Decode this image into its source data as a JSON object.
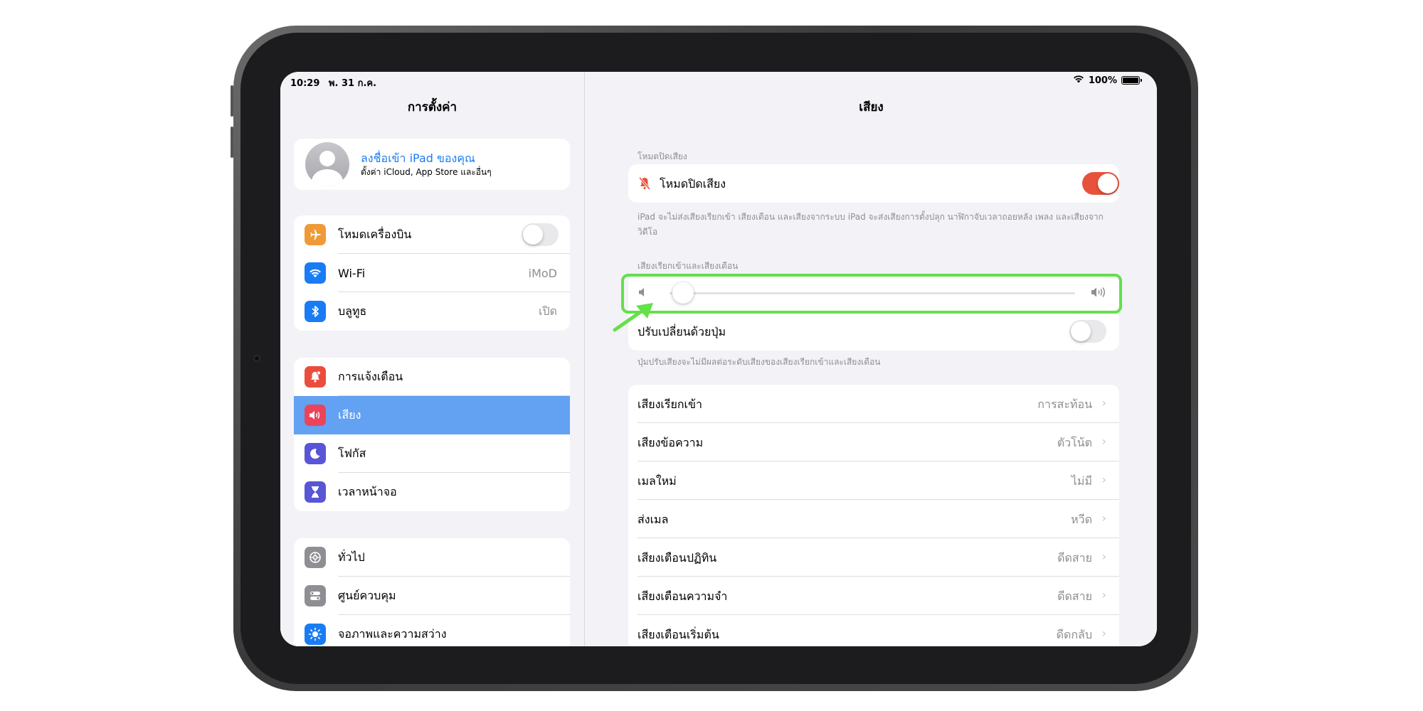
{
  "status_bar": {
    "time": "10:29",
    "date": "พ. 31 ก.ค.",
    "battery": "100%"
  },
  "sidebar": {
    "title": "การตั้งค่า",
    "profile": {
      "name": "ลงชื่อเข้า iPad ของคุณ",
      "subtitle": "ตั้งค่า iCloud, App Store และอื่นๆ"
    },
    "group1": [
      {
        "label": "โหมดเครื่องบิน",
        "icon": "airplane-icon",
        "color": "#f09a37"
      },
      {
        "label": "Wi-Fi",
        "value": "iMoD",
        "icon": "wifi-icon",
        "color": "#1a7cf5"
      },
      {
        "label": "บลูทูธ",
        "value": "เปิด",
        "icon": "bluetooth-icon",
        "color": "#1a7cf5"
      }
    ],
    "group2": [
      {
        "label": "การแจ้งเตือน",
        "icon": "bell-badge-icon",
        "color": "#eb4d3d"
      },
      {
        "label": "เสียง",
        "icon": "speaker-icon",
        "color": "#eb445a",
        "selected": true
      },
      {
        "label": "โฟกัส",
        "icon": "moon-icon",
        "color": "#5856d6"
      },
      {
        "label": "เวลาหน้าจอ",
        "icon": "hourglass-icon",
        "color": "#5856d6"
      }
    ],
    "group3": [
      {
        "label": "ทั่วไป",
        "icon": "gear-icon",
        "color": "#8e8e93"
      },
      {
        "label": "ศูนย์ควบคุม",
        "icon": "switches-icon",
        "color": "#8e8e93"
      },
      {
        "label": "จอภาพและความสว่าง",
        "icon": "sun-icon",
        "color": "#1a7cf5"
      }
    ]
  },
  "detail": {
    "title": "เสียง",
    "silent_header": "โหมดปิดเสียง",
    "silent_label": "โหมดปิดเสียง",
    "silent_on": true,
    "silent_footer": "iPad จะไม่ส่งเสียงเรียกเข้า เสียงเตือน และเสียงจากระบบ iPad จะส่งเสียงการตั้งปลุก นาฬิกาจับเวลาถอยหลัง เพลง และเสียงจากวิดีโอ",
    "ringer_header": "เสียงเรียกเข้าและเสียงเตือน",
    "ringer_level": 0.04,
    "change_with_buttons_label": "ปรับเปลี่ยนด้วยปุ่ม",
    "change_with_buttons_on": false,
    "buttons_footer": "ปุ่มปรับเสียงจะไม่มีผลต่อระดับเสียงของเสียงเรียกเข้าและเสียงเตือน",
    "sounds": [
      {
        "label": "เสียงเรียกเข้า",
        "value": "การสะท้อน"
      },
      {
        "label": "เสียงข้อความ",
        "value": "ตัวโน้ต"
      },
      {
        "label": "เมลใหม่",
        "value": "ไม่มี"
      },
      {
        "label": "ส่งเมล",
        "value": "หวีด"
      },
      {
        "label": "เสียงเตือนปฏิทิน",
        "value": "ดีดสาย"
      },
      {
        "label": "เสียงเตือนความจำ",
        "value": "ดีดสาย"
      },
      {
        "label": "เสียงเตือนเริ่มต้น",
        "value": "ดีดกลับ"
      }
    ]
  },
  "colors": {
    "accent": "#1a7cf5",
    "selected_row": "#63a1f2",
    "toggle_on": "#e8523c",
    "highlight": "#63e04a"
  }
}
